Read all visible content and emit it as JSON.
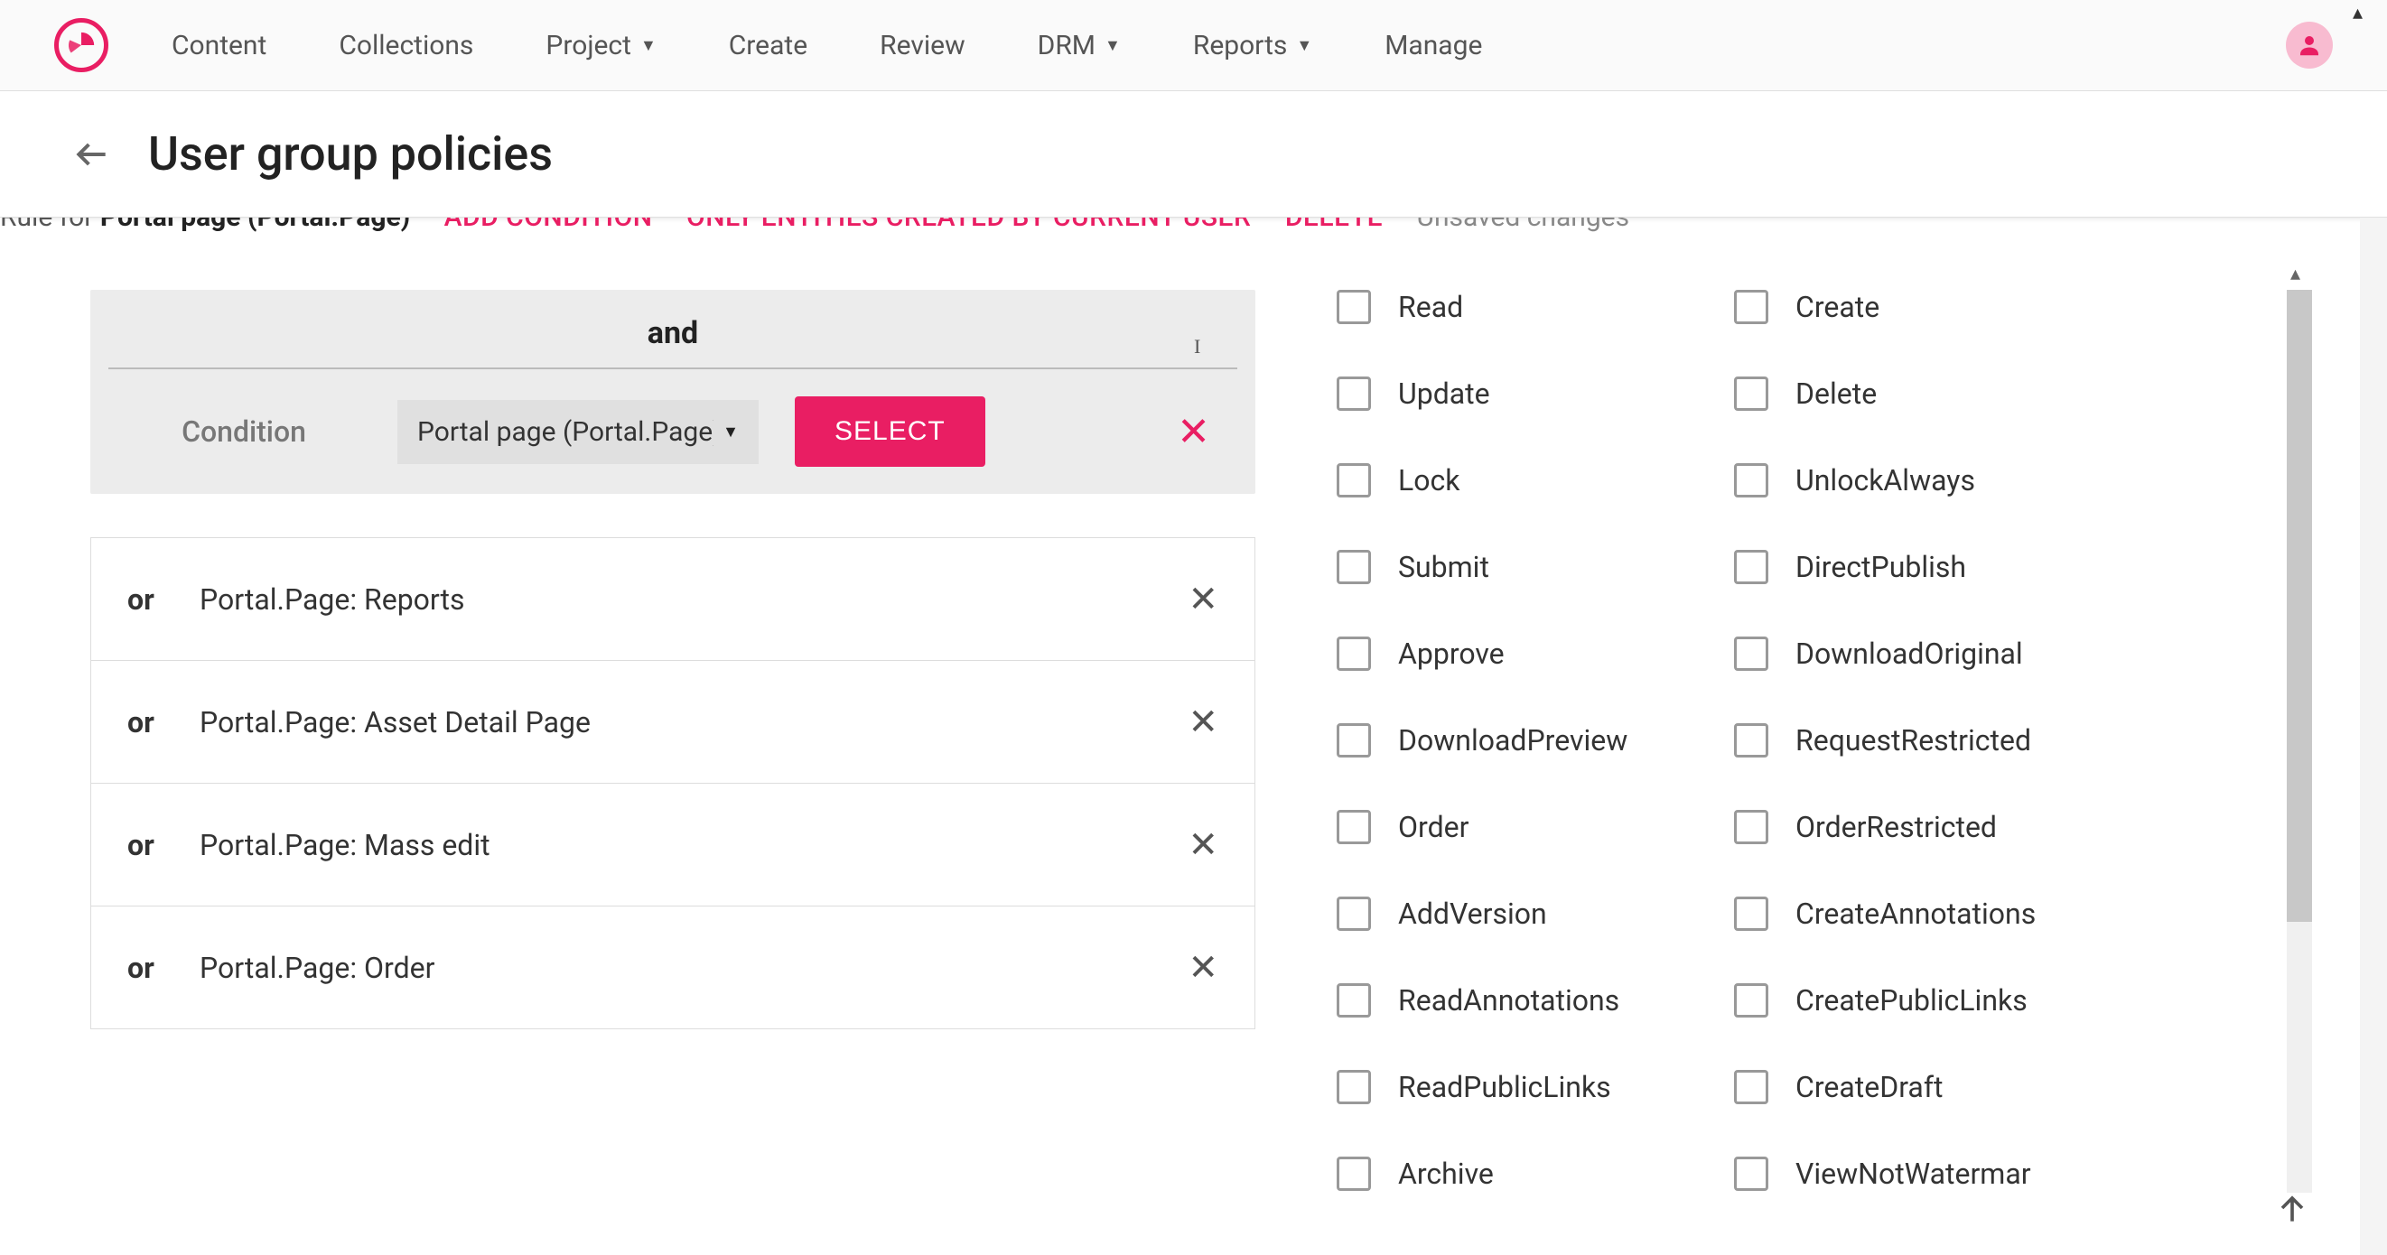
{
  "nav": {
    "items": [
      {
        "label": "Content",
        "has_menu": false
      },
      {
        "label": "Collections",
        "has_menu": false
      },
      {
        "label": "Project",
        "has_menu": true
      },
      {
        "label": "Create",
        "has_menu": false
      },
      {
        "label": "Review",
        "has_menu": false
      },
      {
        "label": "DRM",
        "has_menu": true
      },
      {
        "label": "Reports",
        "has_menu": true
      },
      {
        "label": "Manage",
        "has_menu": false
      }
    ]
  },
  "page": {
    "title": "User group policies"
  },
  "rule_header": {
    "prefix": "Rule for",
    "entity": "Portal page (Portal.Page)",
    "add_condition": "ADD CONDITION",
    "only_entities": "ONLY ENTITIES CREATED BY CURRENT USER",
    "delete": "DELETE",
    "unsaved": "Unsaved changes"
  },
  "condition": {
    "and_label": "and",
    "label": "Condition",
    "dropdown_value": "Portal page (Portal.Page)",
    "select_button": "SELECT"
  },
  "or_rows": [
    {
      "op": "or",
      "value": "Portal.Page: Reports"
    },
    {
      "op": "or",
      "value": "Portal.Page: Asset Detail Page"
    },
    {
      "op": "or",
      "value": "Portal.Page: Mass edit"
    },
    {
      "op": "or",
      "value": "Portal.Page: Order"
    }
  ],
  "permissions": {
    "left": [
      "Read",
      "Update",
      "Lock",
      "Submit",
      "Approve",
      "DownloadPreview",
      "Order",
      "AddVersion",
      "ReadAnnotations",
      "ReadPublicLinks",
      "Archive"
    ],
    "right": [
      "Create",
      "Delete",
      "UnlockAlways",
      "DirectPublish",
      "DownloadOriginal",
      "RequestRestricted",
      "OrderRestricted",
      "CreateAnnotations",
      "CreatePublicLinks",
      "CreateDraft",
      "ViewNotWatermar"
    ]
  },
  "colors": {
    "accent": "#e91e63"
  }
}
